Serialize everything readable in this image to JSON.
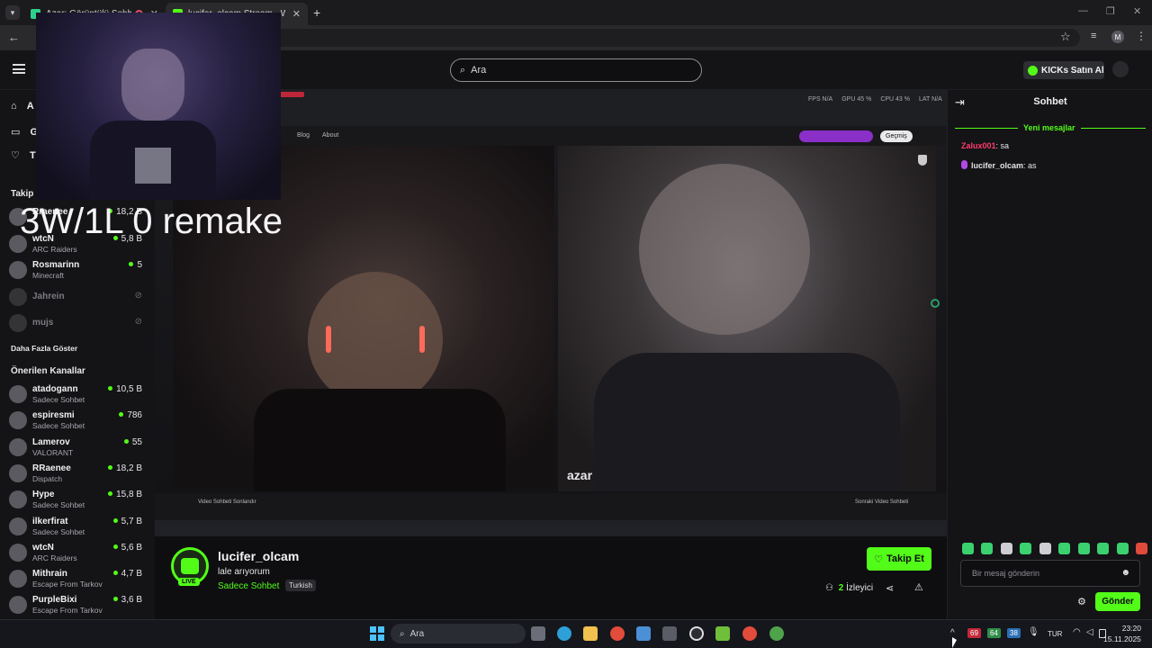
{
  "browser": {
    "tabs": [
      {
        "label": "Azar: Görüntülü Sohbet, Yen",
        "active": false
      },
      {
        "label": "lucifer_olcam Stream - Watch Li",
        "active": true
      }
    ],
    "new_tab": "+"
  },
  "header": {
    "search_placeholder": "Ara",
    "kicks_label": "KICKs Satın Al"
  },
  "overlay": {
    "text": "3W/1L 0 remake"
  },
  "sidebar": {
    "nav": [
      {
        "label": "A",
        "icon": "home-icon"
      },
      {
        "label": "G",
        "icon": "browse-icon"
      },
      {
        "label": "T",
        "icon": "heart-icon"
      }
    ],
    "following_title": "Takip E",
    "following": [
      {
        "name": "Rraenee",
        "category": "",
        "viewers": "18,2 B"
      },
      {
        "name": "wtcN",
        "category": "ARC Raiders",
        "viewers": "5,8 B"
      },
      {
        "name": "Rosmarinn",
        "category": "Minecraft",
        "viewers": "5"
      },
      {
        "name": "Jahrein",
        "category": "",
        "viewers": "",
        "offline": true
      },
      {
        "name": "mujs",
        "category": "",
        "viewers": "",
        "offline": true
      }
    ],
    "show_more": "Daha Fazla Göster",
    "recommended_title": "Önerilen Kanallar",
    "recommended": [
      {
        "name": "atadogann",
        "category": "Sadece Sohbet",
        "viewers": "10,5 B"
      },
      {
        "name": "espiresmi",
        "category": "Sadece Sohbet",
        "viewers": "786"
      },
      {
        "name": "Lamerov",
        "category": "VALORANT",
        "viewers": "55"
      },
      {
        "name": "RRaenee",
        "category": "Dispatch",
        "viewers": "18,2 B"
      },
      {
        "name": "Hype",
        "category": "Sadece Sohbet",
        "viewers": "15,8 B"
      },
      {
        "name": "ilkerfirat",
        "category": "Sadece Sohbet",
        "viewers": "5,7 B"
      },
      {
        "name": "wtcN",
        "category": "ARC Raiders",
        "viewers": "5,6 B"
      },
      {
        "name": "Mithrain",
        "category": "Escape From Tarkov",
        "viewers": "4,7 B"
      },
      {
        "name": "PurpleBixi",
        "category": "Escape From Tarkov",
        "viewers": "3,6 B"
      }
    ]
  },
  "video": {
    "inner_nav": [
      "Blog",
      "About"
    ],
    "inner_stats": [
      "FPS N/A",
      "GPU 45 %",
      "CPU 43 %",
      "LAT N/A"
    ],
    "gecmis": "Geçmiş",
    "azar_logo": "azar",
    "bottom_left": "Video Sohbeti Sonlandır",
    "bottom_right": "Sonraki Video Sohbeti"
  },
  "stream": {
    "channel": "lucifer_olcam",
    "title": "lale arıyorum",
    "category": "Sadece Sohbet",
    "tag": "Turkish",
    "live_badge": "LIVE",
    "follow_label": "Takip Et",
    "viewers_count": "2",
    "viewers_label": "İzleyici"
  },
  "chat": {
    "title": "Sohbet",
    "new_messages": "Yeni mesajlar",
    "messages": [
      {
        "user": "Zalux001",
        "text": ": sa",
        "color": "#ff3b6b"
      },
      {
        "user": "lucifer_olcam",
        "text": ": as",
        "color": "#e5e5e8"
      }
    ],
    "input_placeholder": "Bir mesaj gönderin",
    "send_label": "Gönder"
  },
  "taskbar": {
    "search_label": "Ara",
    "tray_badges": [
      "69",
      "64",
      "38"
    ],
    "lang": "TUR",
    "time": "23:20",
    "date": "15.11.2025"
  },
  "colors": {
    "accent": "#53fc18",
    "bg": "#0b0b0e",
    "panel": "#141417"
  }
}
